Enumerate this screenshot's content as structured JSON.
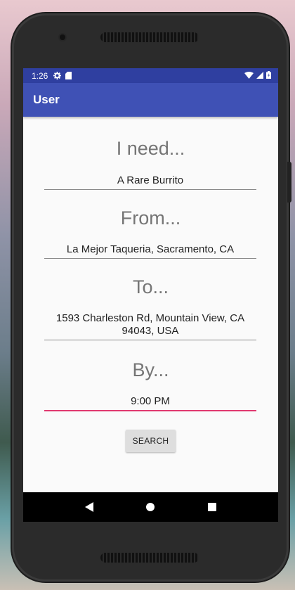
{
  "status_bar": {
    "time": "1:26",
    "icons": [
      "gear-icon",
      "sd-card-icon"
    ],
    "right_icons": [
      "wifi-icon",
      "signal-icon",
      "battery-icon"
    ]
  },
  "app_bar": {
    "title": "User"
  },
  "form": {
    "need_heading": "I need...",
    "need_value": "A Rare Burrito",
    "from_heading": "From...",
    "from_value": "La Mejor Taqueria, Sacramento, CA",
    "to_heading": "To...",
    "to_value": "1593 Charleston Rd, Mountain View, CA 94043, USA",
    "by_heading": "By...",
    "by_value": "9:00 PM",
    "search_label": "SEARCH"
  },
  "nav_bar": {
    "buttons": [
      "back-icon",
      "home-icon",
      "recents-icon"
    ]
  },
  "colors": {
    "primary": "#3f51b5",
    "primary_dark": "#2f3fa0",
    "accent": "#e0386f"
  }
}
